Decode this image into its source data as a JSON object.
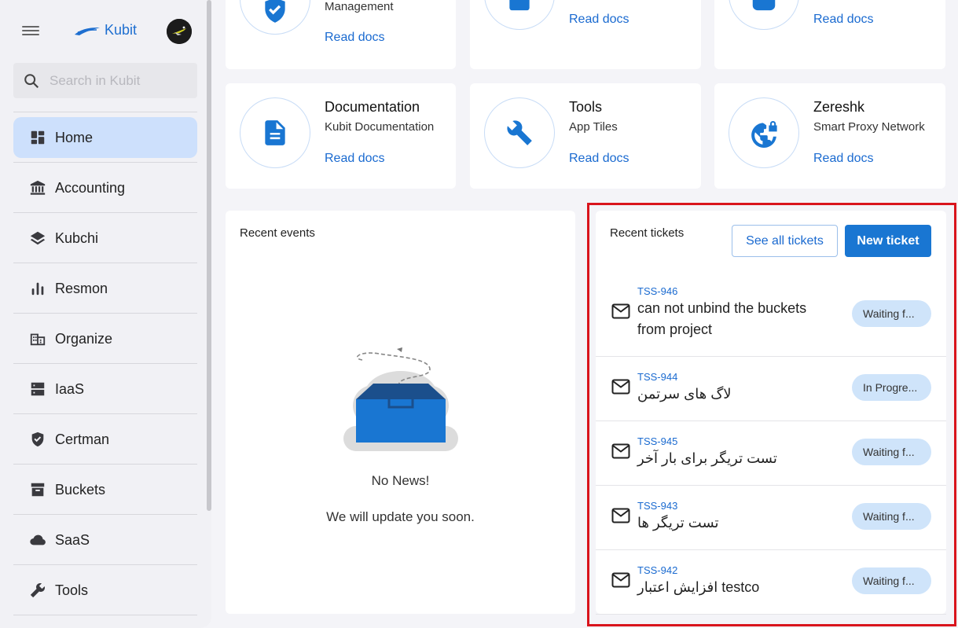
{
  "app": {
    "brand": "Kubit"
  },
  "search": {
    "placeholder": "Search in Kubit"
  },
  "sidebar": {
    "items": [
      {
        "label": "Home",
        "icon": "dashboard-icon",
        "active": true
      },
      {
        "label": "Accounting",
        "icon": "bank-icon"
      },
      {
        "label": "Kubchi",
        "icon": "layers-icon"
      },
      {
        "label": "Resmon",
        "icon": "bar-chart-icon"
      },
      {
        "label": "Organize",
        "icon": "building-icon"
      },
      {
        "label": "IaaS",
        "icon": "server-icon"
      },
      {
        "label": "Certman",
        "icon": "shield-check-icon"
      },
      {
        "label": "Buckets",
        "icon": "archive-icon"
      },
      {
        "label": "SaaS",
        "icon": "cloud-icon"
      },
      {
        "label": "Tools",
        "icon": "wrench-icon"
      }
    ]
  },
  "cards_top": [
    {
      "subtitle": "Management",
      "link": "Read docs",
      "icon": "shield-check-icon"
    },
    {
      "link": "Read docs",
      "icon": "square-icon"
    },
    {
      "link": "Read docs",
      "icon": "square-icon"
    }
  ],
  "cards": [
    {
      "title": "Documentation",
      "subtitle": "Kubit Documentation",
      "link": "Read docs",
      "icon": "document-icon"
    },
    {
      "title": "Tools",
      "subtitle": "App Tiles",
      "link": "Read docs",
      "icon": "wrench-icon"
    },
    {
      "title": "Zereshk",
      "subtitle": "Smart Proxy Network",
      "link": "Read docs",
      "icon": "globe-lock-icon"
    }
  ],
  "events": {
    "title": "Recent events",
    "empty_title": "No News!",
    "empty_sub": "We will update you soon."
  },
  "tickets": {
    "title": "Recent tickets",
    "see_all": "See all tickets",
    "new_ticket": "New ticket",
    "items": [
      {
        "id": "TSS-946",
        "title": "can not unbind the buckets from project",
        "status": "Waiting f..."
      },
      {
        "id": "TSS-944",
        "title": "لاگ های سرتمن",
        "status": "In Progre..."
      },
      {
        "id": "TSS-945",
        "title": "تست تریگر برای بار آخر",
        "status": "Waiting f..."
      },
      {
        "id": "TSS-943",
        "title": "تست تریگر ها",
        "status": "Waiting f..."
      },
      {
        "id": "TSS-942",
        "title": "افزایش اعتبار testco",
        "status": "Waiting f..."
      }
    ]
  },
  "colors": {
    "accent": "#1976d2",
    "active_nav": "#cde0fc",
    "status_chip": "#cfe4fa",
    "highlight_box": "#d9141c"
  }
}
